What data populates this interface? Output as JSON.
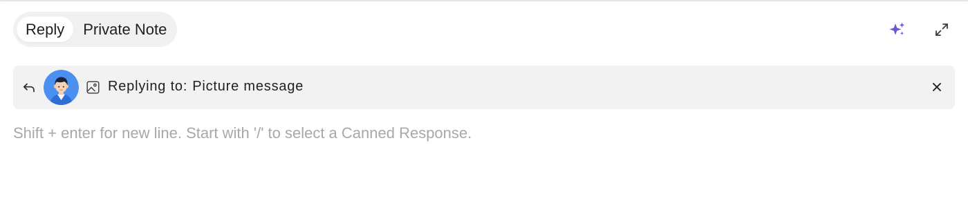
{
  "tabs": {
    "reply_label": "Reply",
    "private_note_label": "Private Note",
    "active": "reply"
  },
  "top_actions": {
    "ai_icon": "sparkle-icon",
    "expand_icon": "expand-icon",
    "ai_color": "#6e56cf"
  },
  "reply_context": {
    "back_icon": "reply-arrow-icon",
    "avatar": "avatar",
    "attachment_icon": "image-icon",
    "prefix": "Replying to:",
    "message": "Picture message",
    "close_icon": "close-icon"
  },
  "composer": {
    "value": "",
    "placeholder": "Shift + enter for new line. Start with '/' to select a Canned Response."
  }
}
